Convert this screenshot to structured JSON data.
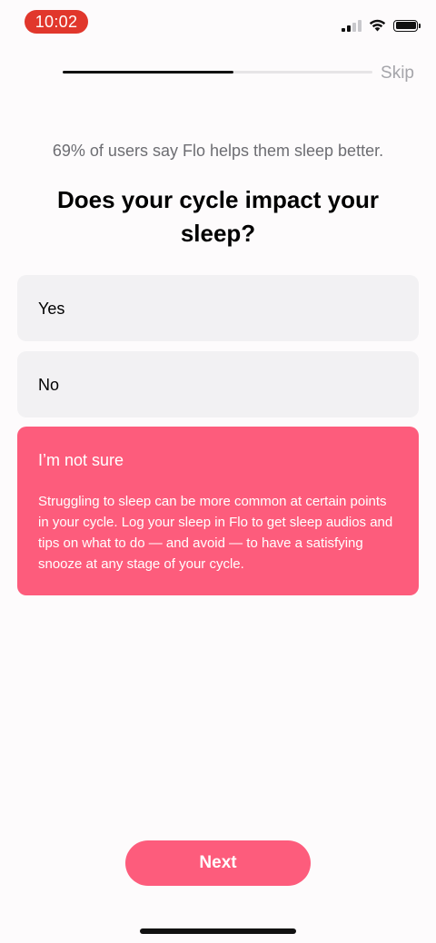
{
  "status_bar": {
    "time": "10:02",
    "time_pill_color": "#e1372c",
    "icons": [
      "cellular-signal-icon",
      "wifi-icon",
      "battery-icon"
    ]
  },
  "onboarding": {
    "progress_fraction": 0.55,
    "skip_label": "Skip"
  },
  "content": {
    "stat": "69% of users say Flo helps them sleep better.",
    "question": "Does your cycle impact your sleep?"
  },
  "options": [
    {
      "label": "Yes",
      "selected": false
    },
    {
      "label": "No",
      "selected": false
    },
    {
      "label": "I’m not sure",
      "selected": true,
      "description": "Struggling to sleep can be more common at certain points in your cycle. Log your sleep in Flo to get sleep audios and tips on what to do — and avoid — to have a satisfying snooze at any stage of your cycle."
    }
  ],
  "footer": {
    "next_label": "Next"
  },
  "colors": {
    "accent": "#fd5c7c",
    "option_bg": "#f2f1f3",
    "background": "#fdfbfc"
  }
}
